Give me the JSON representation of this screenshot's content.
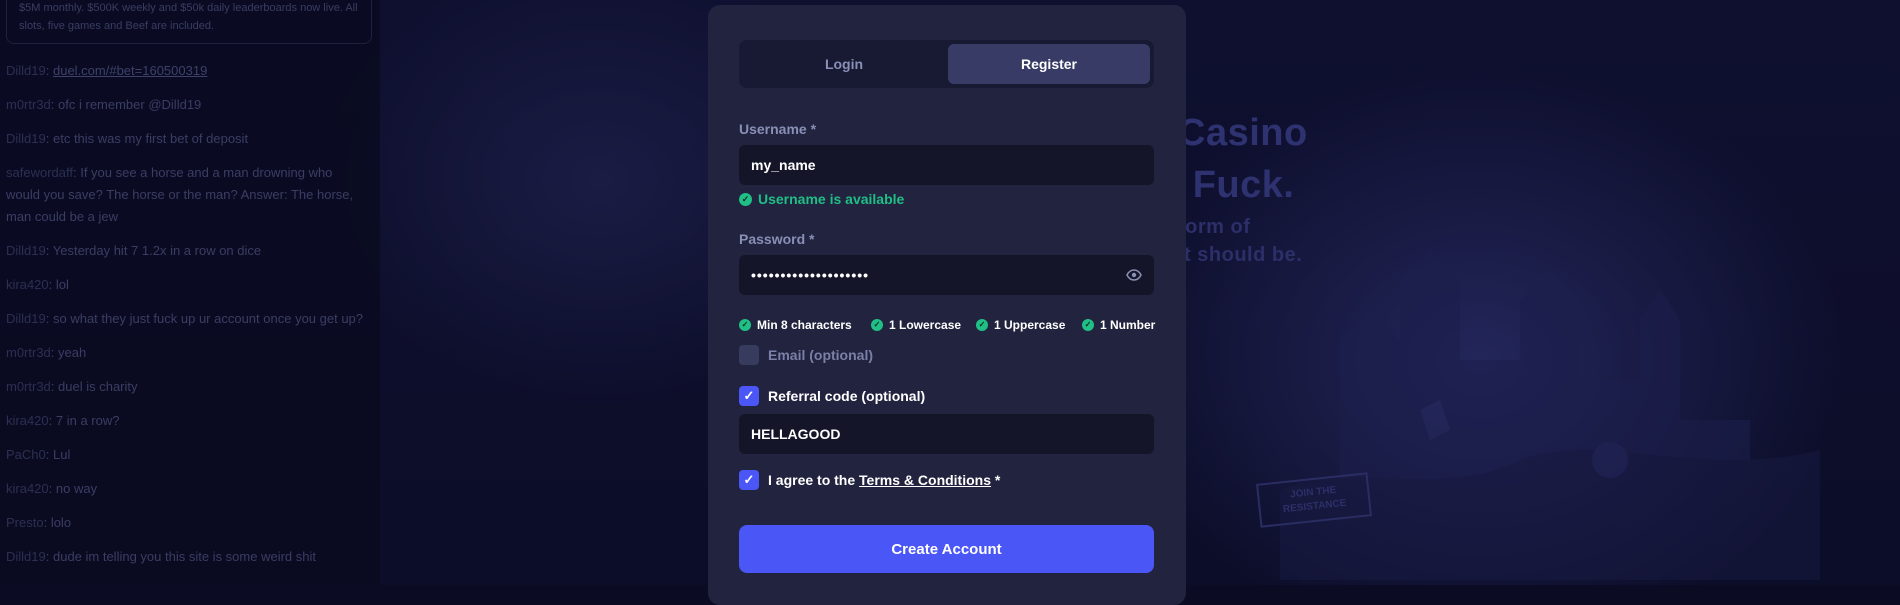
{
  "chat": {
    "notice": "$5M monthly. $500K weekly and $50k daily leaderboards now live. All slots, five games and Beef are included.",
    "messages": [
      {
        "user": "Dilld19",
        "text": "duel.com/#bet=160500319",
        "is_link": true
      },
      {
        "user": "m0rtr3d",
        "text": "ofc i remember @Dilld19"
      },
      {
        "user": "Dilld19",
        "text": "etc this was my first bet of deposit"
      },
      {
        "user": "safewordaff",
        "text": "If you see a horse and a man drowning who would you save? The horse or the man? Answer: The horse, man could be a jew"
      },
      {
        "user": "Dilld19",
        "text": "Yesterday hit 7 1.2x in a row on dice"
      },
      {
        "user": "kira420",
        "text": "lol"
      },
      {
        "user": "Dilld19",
        "text": "so what they just fuck up ur account once you get up?"
      },
      {
        "user": "m0rtr3d",
        "text": "yeah"
      },
      {
        "user": "m0rtr3d",
        "text": "duel is charity"
      },
      {
        "user": "kira420",
        "text": "7 in a row?"
      },
      {
        "user": "PaCh0",
        "text": "Lul"
      },
      {
        "user": "kira420",
        "text": "no way"
      },
      {
        "user": "Presto",
        "text": "lolo"
      },
      {
        "user": "Dilld19",
        "text": "dude im telling you this site is some weird shit"
      }
    ]
  },
  "background": {
    "heading_line1": "Casino",
    "heading_line2": "a Fuck.",
    "paragraph_line1": "form of",
    "paragraph_line2": "it should be.",
    "sign_text": "JOIN THE RESISTANCE"
  },
  "modal": {
    "tabs": [
      {
        "label": "Login",
        "active": false
      },
      {
        "label": "Register",
        "active": true
      }
    ],
    "username": {
      "label": "Username *",
      "value": "my_name",
      "status": "Username is available"
    },
    "password": {
      "label": "Password *",
      "value": "••••••••••••••••••••",
      "requirements": [
        "Min 8 characters",
        "1 Lowercase",
        "1 Uppercase",
        "1 Number"
      ]
    },
    "email": {
      "label": "Email (optional)",
      "checked": false
    },
    "referral": {
      "label": "Referral code (optional)",
      "checked": true,
      "value": "HELLAGOOD"
    },
    "terms": {
      "prefix": "I agree to the ",
      "link": "Terms & Conditions",
      "suffix": " *",
      "checked": true
    },
    "submit_label": "Create Account"
  },
  "colors": {
    "accent": "#4a56f5",
    "success": "#1fbf85",
    "modal_bg": "#21233f",
    "page_bg": "#0b0c24"
  },
  "icons": {
    "check": "check-icon",
    "status_ok": "check-circle-icon",
    "password_visibility": "eye-icon"
  }
}
